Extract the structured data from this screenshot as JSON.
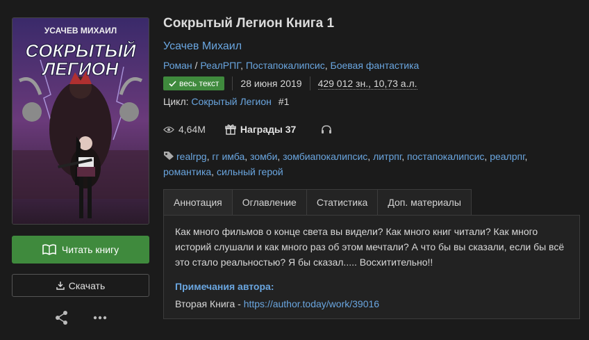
{
  "cover": {
    "author_text": "УСАЧЕВ МИХАИЛ",
    "title_line1": "СОКРЫТЫЙ",
    "title_line2": "ЛЕГИОН"
  },
  "actions": {
    "read_label": "Читать книгу",
    "download_label": "Скачать"
  },
  "book": {
    "title": "Сокрытый Легион Книга 1",
    "author": "Усачев Михаил",
    "genres": [
      "Роман",
      "РеалРПГ",
      "Постапокалипсис",
      "Боевая фантастика"
    ],
    "status_badge": "весь текст",
    "date": "28 июня 2019",
    "size": "429 012 зн., 10,73 а.л.",
    "cycle_label": "Цикл:",
    "cycle_name": "Сокрытый Легион",
    "cycle_number": "#1",
    "views": "4,64М",
    "awards": "Награды 37",
    "tags": [
      "realrpg",
      "гг имба",
      "зомби",
      "зомбиапокалипсис",
      "литрпг",
      "постапокалипсис",
      "реалрпг",
      "романтика",
      "сильный герой"
    ]
  },
  "tabs": [
    "Аннотация",
    "Оглавление",
    "Статистика",
    "Доп. материалы"
  ],
  "annotation": {
    "text": "Как много фильмов о конце света вы видели? Как много книг читали? Как много историй слушали и как много раз об этом мечтали? А что бы вы сказали, если бы всё это стало реальностью? Я бы сказал..... Восхитительно!!",
    "notes_heading": "Примечания автора:",
    "notes_prefix": "Вторая Книга - ",
    "notes_link": "https://author.today/work/39016"
  },
  "colors": {
    "accent_green": "#3f8a3d",
    "link": "#6aa6e0"
  }
}
